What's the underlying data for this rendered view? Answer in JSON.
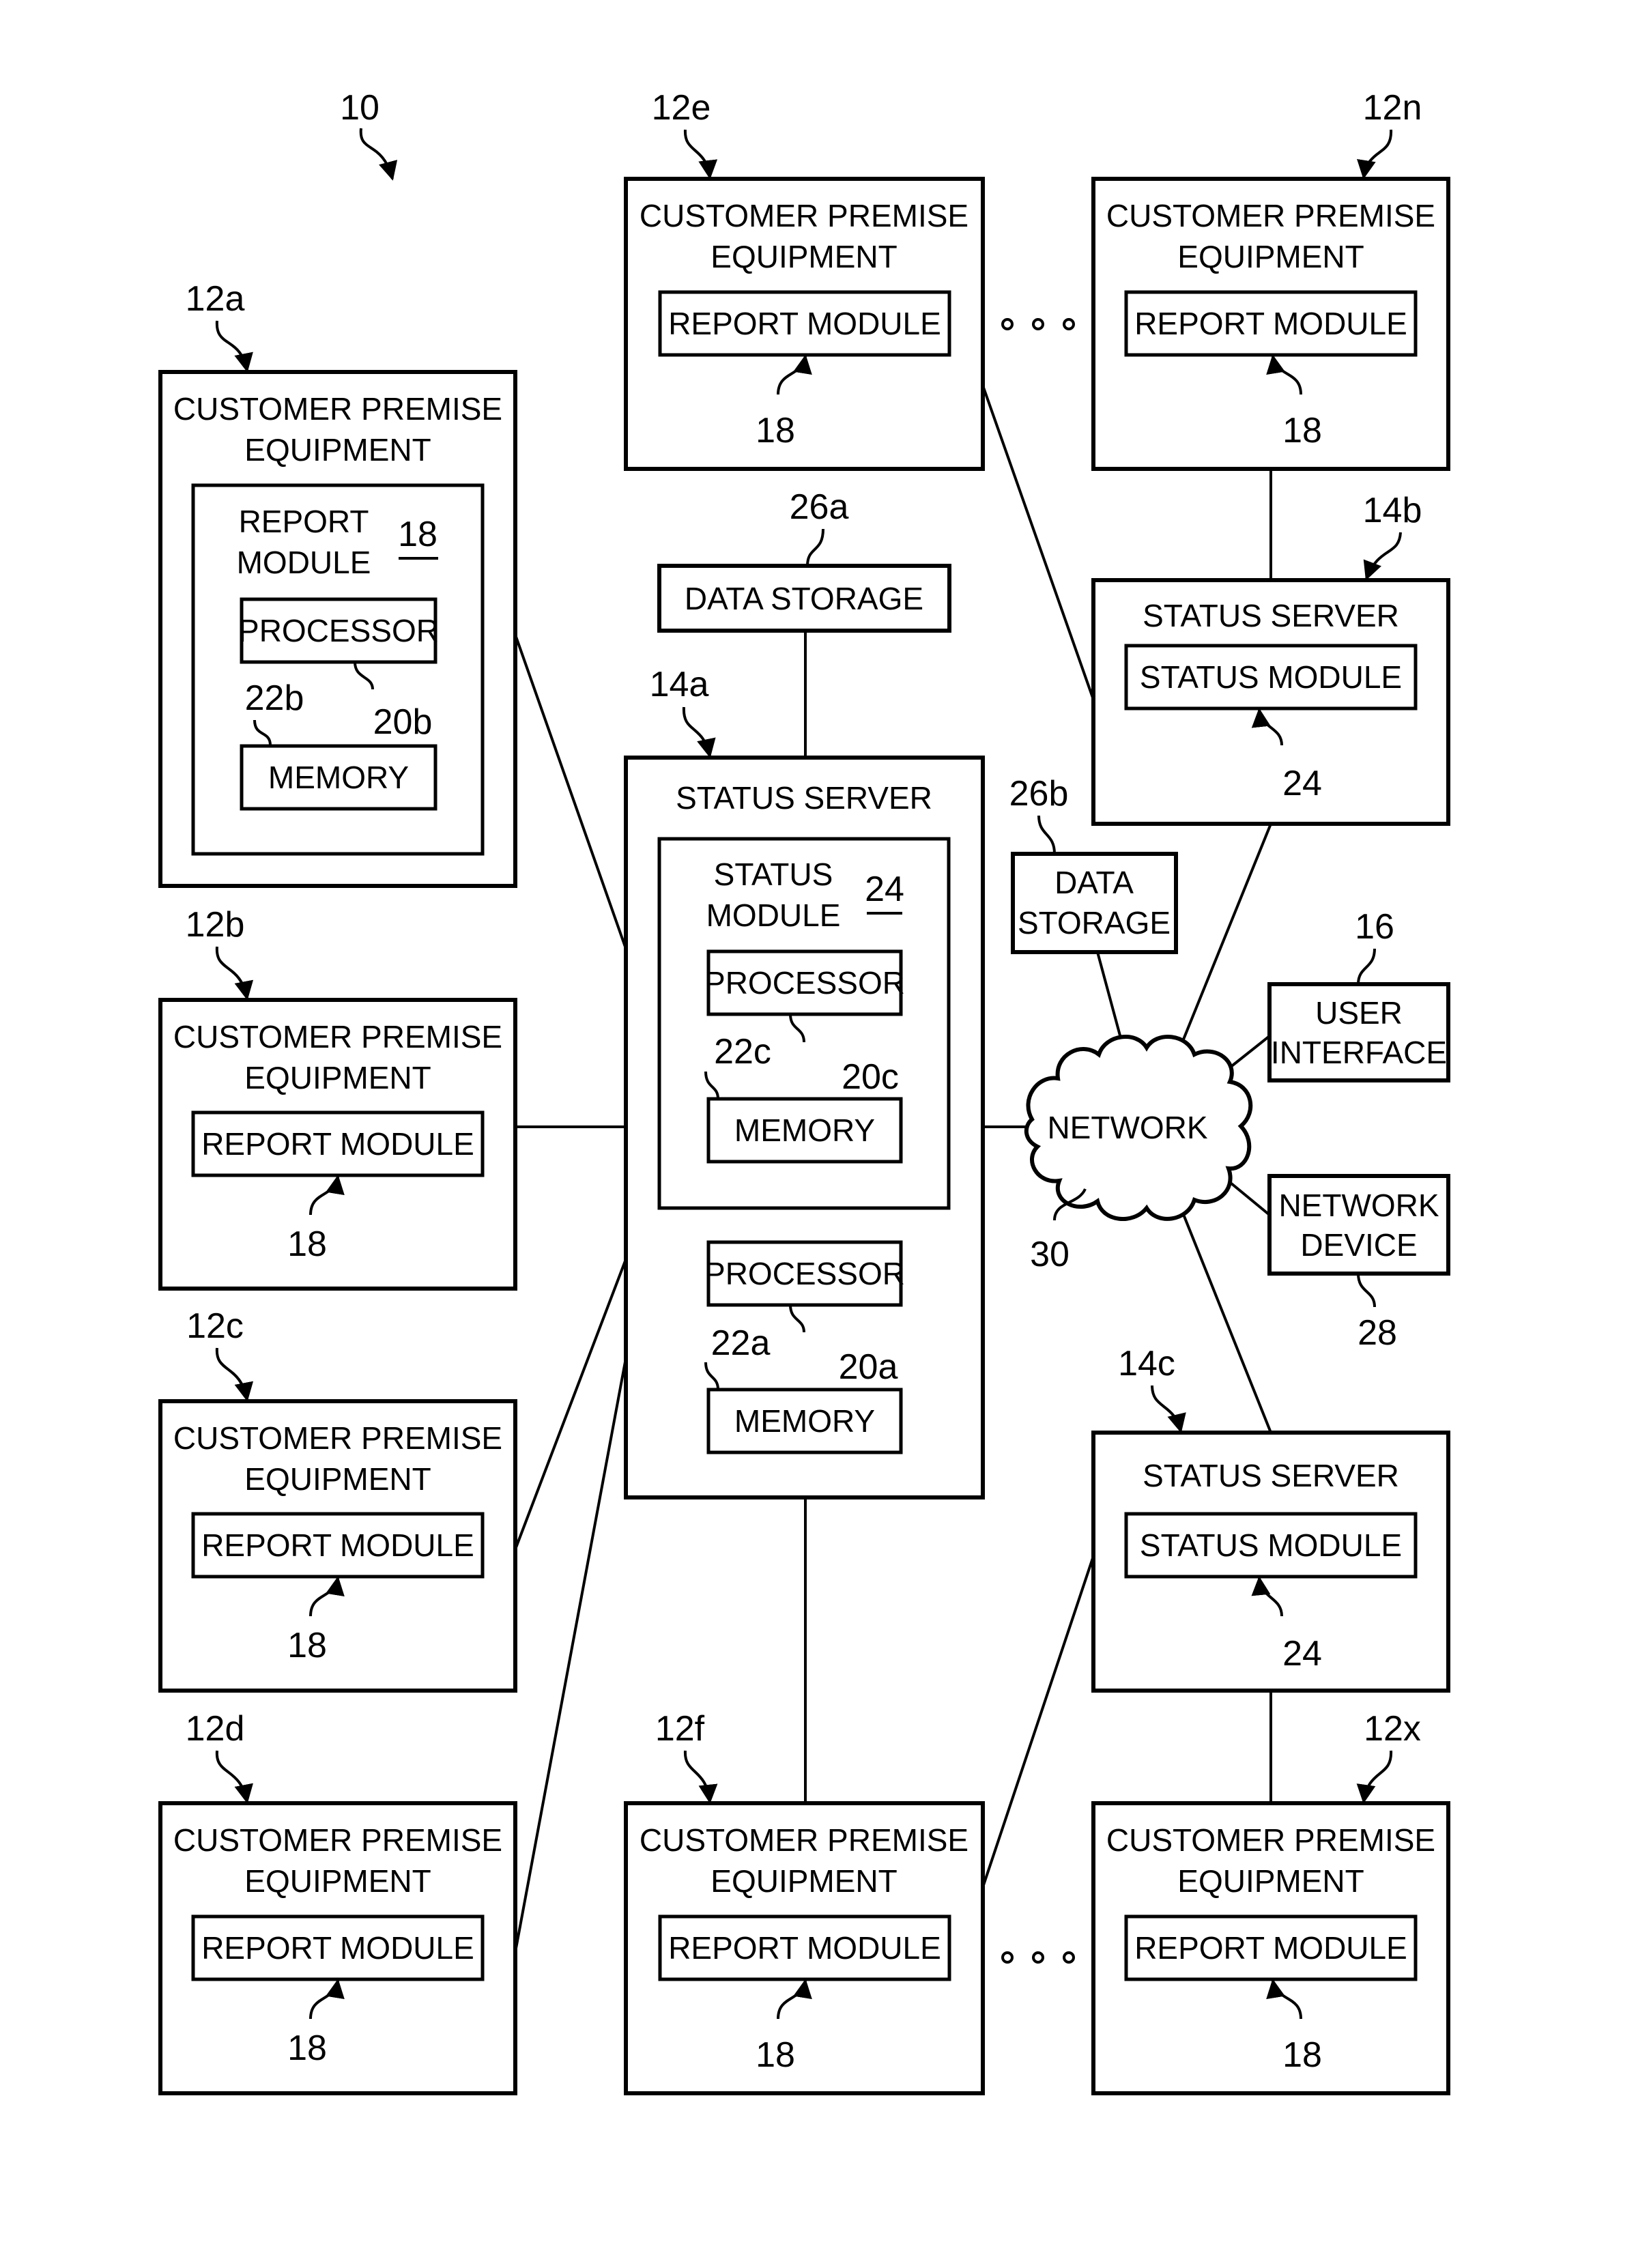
{
  "figure": {
    "system_ref": "10",
    "colors": {
      "line": "#000000",
      "background": "#ffffff"
    }
  },
  "cpe": {
    "a": {
      "ref": "12a",
      "title_l1": "CUSTOMER PREMISE",
      "title_l2": "EQUIPMENT",
      "module_l1": "REPORT",
      "module_l2": "MODULE",
      "module_ref": "18",
      "processor": "PROCESSOR",
      "processor_ref": "20b",
      "memory": "MEMORY",
      "memory_ref": "22b"
    },
    "b": {
      "ref": "12b",
      "title_l1": "CUSTOMER PREMISE",
      "title_l2": "EQUIPMENT",
      "module": "REPORT MODULE",
      "module_ref": "18"
    },
    "c": {
      "ref": "12c",
      "title_l1": "CUSTOMER PREMISE",
      "title_l2": "EQUIPMENT",
      "module": "REPORT MODULE",
      "module_ref": "18"
    },
    "d": {
      "ref": "12d",
      "title_l1": "CUSTOMER PREMISE",
      "title_l2": "EQUIPMENT",
      "module": "REPORT MODULE",
      "module_ref": "18"
    },
    "e": {
      "ref": "12e",
      "title_l1": "CUSTOMER PREMISE",
      "title_l2": "EQUIPMENT",
      "module": "REPORT MODULE",
      "module_ref": "18"
    },
    "n": {
      "ref": "12n",
      "title_l1": "CUSTOMER PREMISE",
      "title_l2": "EQUIPMENT",
      "module": "REPORT MODULE",
      "module_ref": "18"
    },
    "f": {
      "ref": "12f",
      "title_l1": "CUSTOMER PREMISE",
      "title_l2": "EQUIPMENT",
      "module": "REPORT MODULE",
      "module_ref": "18"
    },
    "x": {
      "ref": "12x",
      "title_l1": "CUSTOMER PREMISE",
      "title_l2": "EQUIPMENT",
      "module": "REPORT MODULE",
      "module_ref": "18"
    }
  },
  "servers": {
    "a": {
      "ref": "14a",
      "title": "STATUS SERVER",
      "module_l1": "STATUS",
      "module_l2": "MODULE",
      "module_ref": "24",
      "mod_processor": "PROCESSOR",
      "mod_processor_ref": "20c",
      "mod_memory": "MEMORY",
      "mod_memory_ref": "22c",
      "processor": "PROCESSOR",
      "processor_ref": "20a",
      "memory": "MEMORY",
      "memory_ref": "22a"
    },
    "b": {
      "ref": "14b",
      "title": "STATUS SERVER",
      "module": "STATUS MODULE",
      "module_ref": "24"
    },
    "c": {
      "ref": "14c",
      "title": "STATUS SERVER",
      "module": "STATUS MODULE",
      "module_ref": "24"
    }
  },
  "storage": {
    "a": {
      "ref": "26a",
      "label": "DATA STORAGE"
    },
    "b": {
      "ref": "26b",
      "label_l1": "DATA",
      "label_l2": "STORAGE"
    }
  },
  "network": {
    "ref": "30",
    "label": "NETWORK"
  },
  "user_interface": {
    "ref": "16",
    "label_l1": "USER",
    "label_l2": "INTERFACE"
  },
  "network_device": {
    "ref": "28",
    "label_l1": "NETWORK",
    "label_l2": "DEVICE"
  },
  "ellipsis": {
    "top": "continuation-dots",
    "bottom": "continuation-dots"
  }
}
